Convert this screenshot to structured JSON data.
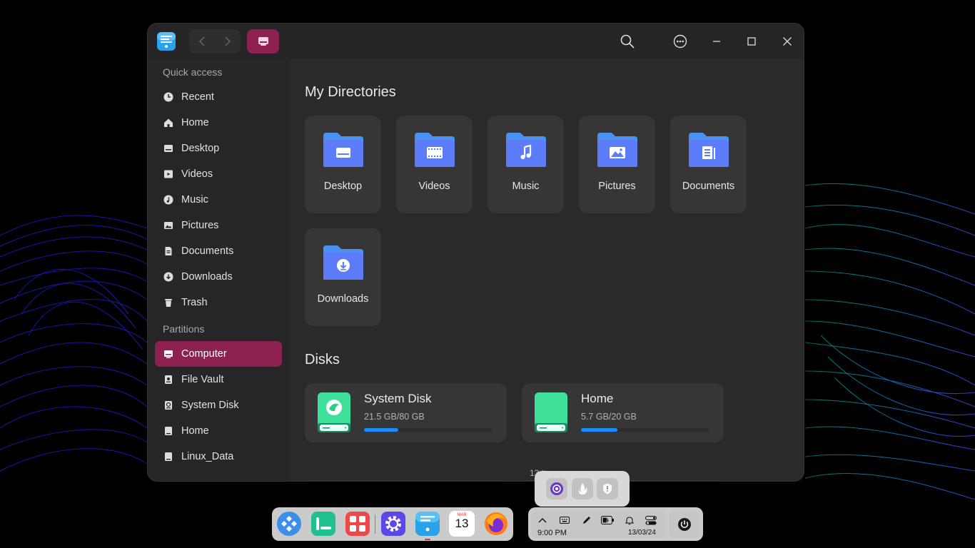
{
  "window": {
    "app_icon": "file-manager-icon",
    "view_icon": "computer-icon"
  },
  "sidebar": {
    "quick_access_label": "Quick access",
    "partitions_label": "Partitions",
    "quick_items": [
      {
        "label": "Recent",
        "icon": "clock-icon"
      },
      {
        "label": "Home",
        "icon": "home-icon"
      },
      {
        "label": "Desktop",
        "icon": "desktop-icon"
      },
      {
        "label": "Videos",
        "icon": "video-icon"
      },
      {
        "label": "Music",
        "icon": "music-icon"
      },
      {
        "label": "Pictures",
        "icon": "picture-icon"
      },
      {
        "label": "Documents",
        "icon": "document-icon"
      },
      {
        "label": "Downloads",
        "icon": "download-icon"
      },
      {
        "label": "Trash",
        "icon": "trash-icon"
      }
    ],
    "partition_items": [
      {
        "label": "Computer",
        "icon": "computer-icon",
        "active": true
      },
      {
        "label": "File Vault",
        "icon": "vault-icon"
      },
      {
        "label": "System Disk",
        "icon": "system-disk-icon"
      },
      {
        "label": "Home",
        "icon": "disk-icon"
      },
      {
        "label": "Linux_Data",
        "icon": "disk-icon"
      }
    ]
  },
  "main": {
    "directories_title": "My Directories",
    "directories": [
      {
        "label": "Desktop",
        "glyph": "desktop"
      },
      {
        "label": "Videos",
        "glyph": "video"
      },
      {
        "label": "Music",
        "glyph": "music"
      },
      {
        "label": "Pictures",
        "glyph": "picture"
      },
      {
        "label": "Documents",
        "glyph": "document"
      },
      {
        "label": "Downloads",
        "glyph": "download"
      }
    ],
    "disks_title": "Disks",
    "disks": [
      {
        "name": "System Disk",
        "size": "21.5 GB/80 GB",
        "used_fraction": 0.269
      },
      {
        "name": "Home",
        "size": "5.7 GB/20 GB",
        "used_fraction": 0.285
      }
    ],
    "status": "13 items"
  },
  "taskbar": {
    "time": "9:00 PM",
    "date": "13/03/24",
    "calendar_month": "MAR",
    "calendar_day": "13",
    "dock_apps": [
      "launcher-icon",
      "multitask-icon",
      "app-store-icon",
      "settings-icon",
      "file-manager-icon",
      "calendar-icon",
      "firefox-icon"
    ],
    "tray_popup": [
      "theme-icon",
      "fire-icon",
      "security-icon"
    ]
  }
}
